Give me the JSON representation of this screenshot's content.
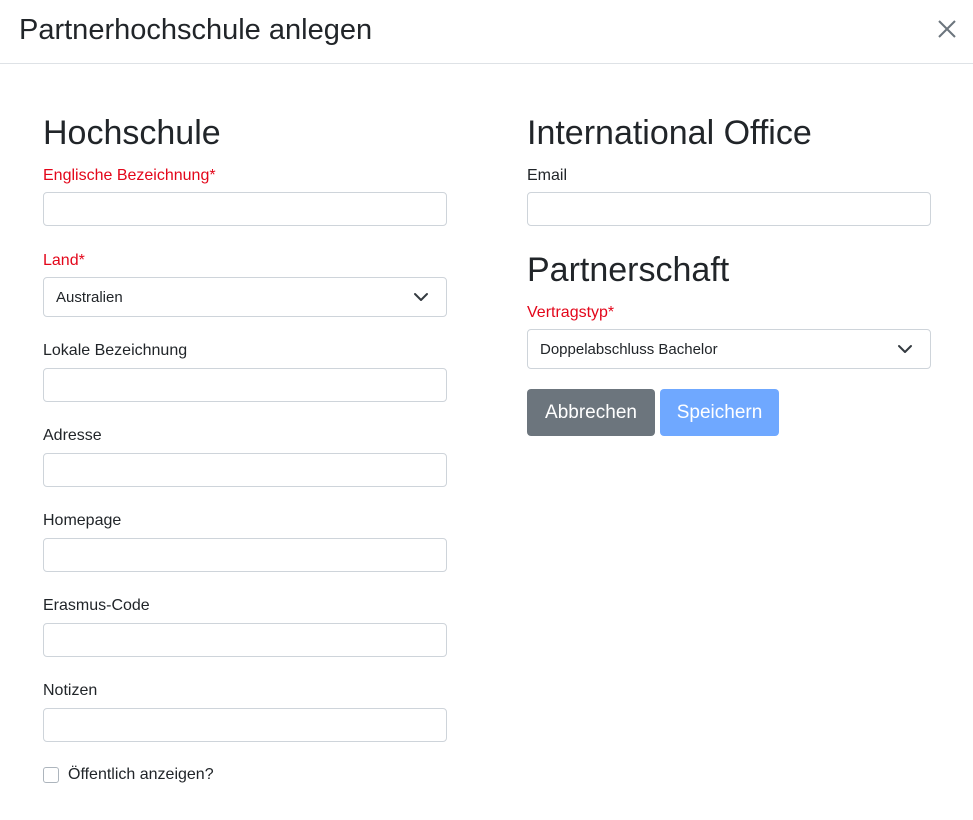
{
  "modal": {
    "title": "Partnerhochschule anlegen",
    "close_icon": "close-icon"
  },
  "hochschule": {
    "heading": "Hochschule",
    "fields": {
      "englische_bezeichnung": {
        "label": "Englische Bezeichnung*",
        "value": "",
        "required": true
      },
      "land": {
        "label": "Land*",
        "selected": "Australien",
        "required": true
      },
      "lokale_bezeichnung": {
        "label": "Lokale Bezeichnung",
        "value": ""
      },
      "adresse": {
        "label": "Adresse",
        "value": ""
      },
      "homepage": {
        "label": "Homepage",
        "value": ""
      },
      "erasmus_code": {
        "label": "Erasmus-Code",
        "value": ""
      },
      "notizen": {
        "label": "Notizen",
        "value": ""
      }
    },
    "public_checkbox": {
      "label": "Öffentlich anzeigen?",
      "checked": false
    }
  },
  "international_office": {
    "heading": "International Office",
    "email": {
      "label": "Email",
      "value": ""
    }
  },
  "partnerschaft": {
    "heading": "Partnerschaft",
    "vertragstyp": {
      "label": "Vertragstyp*",
      "selected": "Doppelabschluss Bachelor",
      "required": true
    }
  },
  "actions": {
    "cancel_label": "Abbrechen",
    "save_label": "Speichern"
  },
  "colors": {
    "required_label": "#e3061a",
    "secondary_button": "#6c757d",
    "primary_button_disabled": "#6fa8ff",
    "border": "#ced4da"
  }
}
